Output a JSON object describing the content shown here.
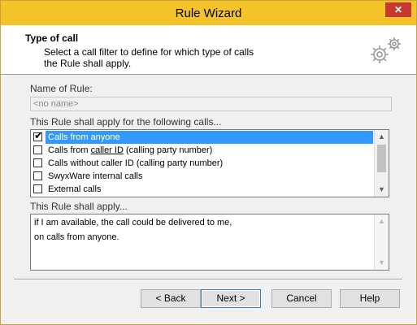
{
  "window": {
    "title": "Rule Wizard",
    "close_symbol": "✕"
  },
  "header": {
    "title": "Type of call",
    "description": "Select a call filter to define for which type of calls the Rule shall apply.",
    "icon": "gears-icon"
  },
  "name_of_rule": {
    "label": "Name of Rule:",
    "placeholder": "<no name>"
  },
  "calls_section": {
    "label": "This Rule shall apply for the following calls...",
    "items": [
      {
        "label": "Calls from anyone",
        "checked": true,
        "selected": true
      },
      {
        "label_pre": "Calls from ",
        "label_underlined": "caller ID",
        "label_post": " (calling party number)",
        "checked": false,
        "selected": false
      },
      {
        "label": "Calls without caller ID (calling party number)",
        "checked": false,
        "selected": false
      },
      {
        "label": "SwyxWare internal calls",
        "checked": false,
        "selected": false
      },
      {
        "label": "External calls",
        "checked": false,
        "selected": false
      }
    ]
  },
  "apply_section": {
    "label": "This Rule shall apply...",
    "lines": [
      "if I am available, the call could be delivered to me,",
      "on calls from anyone."
    ]
  },
  "buttons": {
    "back": "< Back",
    "next": "Next >",
    "cancel": "Cancel",
    "help": "Help"
  },
  "colors": {
    "titlebar": "#f4c32a",
    "selection": "#3399ff",
    "close": "#c7392e"
  }
}
